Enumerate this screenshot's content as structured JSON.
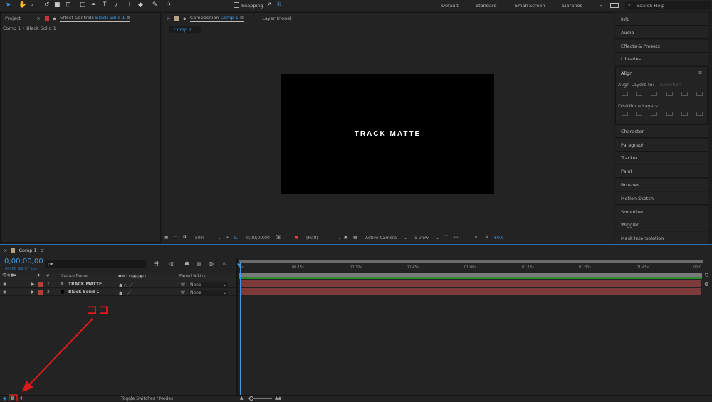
{
  "toolbar": {
    "snapping": "Snapping",
    "workspaces": [
      "Default",
      "Standard",
      "Small Screen",
      "Libraries"
    ],
    "more": "»",
    "search_placeholder": "Search Help"
  },
  "left_panel": {
    "tab_project": "Project",
    "tab_effect_controls": "Effect Controls",
    "effect_layer": "Black Solid 1",
    "breadcrumb": "Comp 1 • Black Solid 1"
  },
  "comp_panel": {
    "tab_label": "Composition",
    "comp_name": "Comp 1",
    "layer_tab": "Layer (none)",
    "sub_tab": "Comp 1",
    "viewer_text": "TRACK MATTE",
    "footer": {
      "zoom": "50%",
      "timecode": "0;00;00;00",
      "resolution": "(Half)",
      "camera": "Active Camera",
      "views": "1 View",
      "exposure": "+0.0"
    }
  },
  "right_panel": {
    "items_top": [
      "Info",
      "Audio",
      "Effects & Presets",
      "Libraries"
    ],
    "align": {
      "title": "Align",
      "align_to_label": "Align Layers to:",
      "align_to_value": "Selection",
      "distribute_label": "Distribute Layers:"
    },
    "items_bottom": [
      "Character",
      "Paragraph",
      "Tracker",
      "Paint",
      "Brushes",
      "Motion Sketch",
      "Smoother",
      "Wiggler",
      "Mask Interpolation"
    ]
  },
  "timeline": {
    "tab": "Comp 1",
    "timecode": "0;00;00;00",
    "frame_info": "00000 (29.97 fps)",
    "search_placeholder": "ρ▾",
    "columns": {
      "num": "#",
      "source": "Source Name",
      "parent": "Parent & Link"
    },
    "layers": [
      {
        "num": "1",
        "type": "T",
        "name": "TRACK MATTE",
        "parent": "None"
      },
      {
        "num": "2",
        "type": "■",
        "name": "Black Solid 1",
        "parent": "None"
      }
    ],
    "ruler": [
      "0s",
      "00:15s",
      "00:30s",
      "00:45s",
      "01:00s",
      "01:15s",
      "01:30s",
      "01:45s",
      "02:0"
    ],
    "toggle": "Toggle Switches / Modes"
  },
  "annotation": {
    "label": "ココ",
    "color": "#e0191b"
  },
  "colors": {
    "accent": "#3d9ae8",
    "label_red": "#c03a3a",
    "layer_bar": "#7d3a3a"
  }
}
